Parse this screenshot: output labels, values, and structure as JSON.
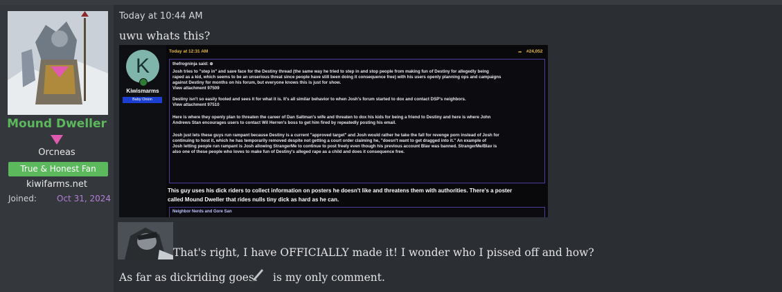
{
  "user": {
    "name": "Mound Dweller",
    "title": "Orcneas",
    "banner": "True & Honest Fan",
    "site": "kiwifarms.net",
    "joined_label": "Joined:",
    "joined_date": "Oct 31, 2024",
    "name_color": "#5cb85c",
    "marker_color": "#e05ab0"
  },
  "post": {
    "timestamp": "Today at 10:44 AM",
    "line1": "uwu whats this?",
    "line2": "That's right, I have OFFICIALLY made it! I wonder who I pissed off and how?",
    "line3_before": "As far as dickriding goes:",
    "line3_after": "is my only comment.",
    "emoji_icon": "knife-icon"
  },
  "screenshot": {
    "avatar_letter": "K",
    "username": "Kiwismarms",
    "banner": "Baby Onion",
    "timestamp": "Today at 12:31 AM",
    "post_number": "#24,052",
    "quote_author": "thefrogninja said: ⊕",
    "quote_lines": [
      "Josh tries to \"step in\" and save face for the Destiny thread (the same way he tried to step in and stop people from making fun of Destiny for allegedly being",
      "raped as a kid, which seems to be an unserious threat since people have still been doing it consequence free) with his users openly planning ops and campaigns",
      "against Destiny for months on his forum, but everyone knows this is just for show.",
      "View attachment 97509",
      "",
      "Destiny isn't so easily fooled and sees it for what it is. It's all similar behavior to when Josh's forum started to dox and contact DSP's neighbors.",
      "View attachment 97510",
      "",
      "Here is where they openly plan to threaten the career of Dan Saltman's wife and threaten to dox his kids for being a friend to Destiny and here is where John",
      "Andrews Stan encourages users to contact Wil Herren's boss to get him fired by repeatedly posting his email.",
      "",
      "Josh just lets these guys run rampant because Destiny is a current \"approved target\" and Josh would rather he take the fall for revenge porn instead of Josh for",
      "continuing to host it, which he has temporarily removed despite not getting a court order claiming he, \"doesn't want to get dragged into it.\" An example of",
      "Josh letting people run rampant is Josh allowing StrangerMe to continue to post freely even though his previous account Blav was banned. StrangerMe/Blav is",
      "also one of these people who loves to make fun of Destiny's alleged rape as a child and does it consequence free."
    ],
    "body_lines": [
      "This guy uses his dick riders to collect information on posters he doesn't like and threatens them with authorities. There's a poster",
      "called Mound Dweller that rides nulls tiny dick as hard as he can."
    ],
    "footer_quote": "Neighbor Nerds and Gore San"
  }
}
